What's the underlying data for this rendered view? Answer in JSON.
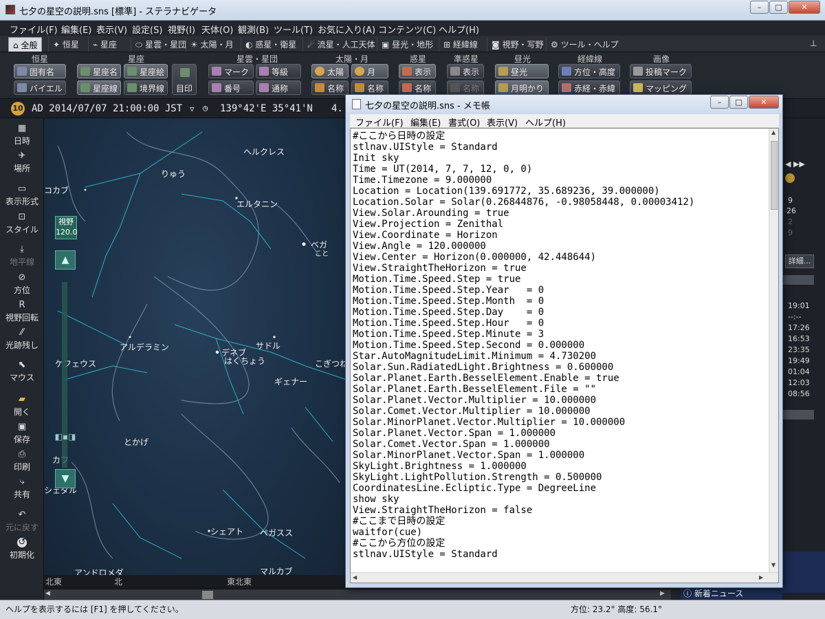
{
  "main": {
    "title": "七夕の星空の説明.sns [標準] - ステラナビゲータ",
    "menu": [
      "ファイル(F)",
      "編集(E)",
      "表示(V)",
      "設定(S)",
      "視野(I)",
      "天体(O)",
      "観測(B)",
      "ツール(T)",
      "お気に入り(A)",
      "コンテンツ(C)",
      "ヘルプ(H)"
    ],
    "tabs": [
      "全般",
      "恒星",
      "星座",
      "星雲・星団",
      "太陽・月",
      "惑星・衛星",
      "流星・人工天体",
      "昼光・地形",
      "経緯線",
      "視野・写野",
      "ツール・ヘルプ"
    ],
    "ribbon_groups": [
      "恒星",
      "星座",
      "星雲・星団",
      "太陽・月",
      "惑星",
      "準惑星",
      "昼光",
      "経緯線",
      "画像"
    ],
    "ribbon_buttons": {
      "star_name": "固有名",
      "bayer": "バイエル",
      "const_name": "星座名",
      "const_picture": "星座絵",
      "const_line": "星座線",
      "boundary": "境界線",
      "const_mark": "目印",
      "neb_mark": "マーク",
      "neb_magnitude": "等級",
      "neb_number": "番号",
      "neb_common": "通称",
      "sun": "太陽",
      "moon": "月",
      "sun_name": "名称",
      "moon_name": "名称",
      "planet_show": "表示",
      "planet_name": "名称",
      "dwarf_show": "表示",
      "dwarf_name": "名称",
      "daylight": "昼光",
      "moonlight": "月明かり",
      "azalt": "方位・高度",
      "radec": "赤経・赤緯",
      "post_mark": "投稿マーク",
      "mapping": "マッピング"
    },
    "status_line": {
      "datetime": "AD 2014/07/07 21:00:00 JST",
      "location": "139°42'E 35°41'N",
      "extra": "4."
    },
    "sidebar": [
      "日時",
      "場所",
      "表示形式",
      "スタイル",
      "地平線",
      "方位",
      "視野回転",
      "光跡残し",
      "マウス",
      "開く",
      "保存",
      "印刷",
      "共有",
      "元に戻す",
      "初期化"
    ],
    "fov_label": "視野",
    "fov_value": "120.0",
    "sky_labels": [
      "りゅう",
      "ヘルクレス",
      "エルタニン",
      "ベガ",
      "こと",
      "コカブ",
      "アルデラミン",
      "デネブ",
      "はくちょう",
      "サドル",
      "ケフェウス",
      "ギェナー",
      "こぎつね",
      "とかげ",
      "カフ",
      "シェダル",
      "シェアト",
      "ペガスス",
      "アンドロメダ",
      "マルカブ"
    ],
    "horizon_labels": [
      "北東",
      "北",
      "東北東"
    ],
    "statusbar": {
      "help": "ヘルプを表示するには [F1] を押してください。",
      "readout": "方位:  23.2°  高度:  56.1°"
    },
    "right_panel": {
      "detail_button": "詳細...",
      "numbers": [
        "9",
        "26",
        "2",
        "9"
      ],
      "times": [
        "19:01",
        "--:--",
        "17:26",
        "16:53",
        "23:35",
        "19:49",
        "01:04",
        "12:03",
        "08:56"
      ],
      "news": "新着ニュース"
    }
  },
  "notepad": {
    "title": "七夕の星空の説明.sns - メモ帳",
    "menu": [
      "ファイル(F)",
      "編集(E)",
      "書式(O)",
      "表示(V)",
      "ヘルプ(H)"
    ],
    "lines": [
      "#ここから日時の設定",
      "stlnav.UIStyle = Standard",
      "Init sky",
      "Time = UT(2014, 7, 7, 12, 0, 0)",
      "Time.Timezone = 9.000000",
      "Location = Location(139.691772, 35.689236, 39.000000)",
      "Location.Solar = Solar(0.26844876, -0.98058448, 0.00003412)",
      "View.Solar.Arounding = true",
      "View.Projection = Zenithal",
      "View.Coordinate = Horizon",
      "View.Angle = 120.000000",
      "View.Center = Horizon(0.000000, 42.448644)",
      "View.StraightTheHorizon = true",
      "Motion.Time.Speed.Step = true",
      "Motion.Time.Speed.Step.Year   = 0",
      "Motion.Time.Speed.Step.Month  = 0",
      "Motion.Time.Speed.Step.Day    = 0",
      "Motion.Time.Speed.Step.Hour   = 0",
      "Motion.Time.Speed.Step.Minute = 3",
      "Motion.Time.Speed.Step.Second = 0.000000",
      "Star.AutoMagnitudeLimit.Minimum = 4.730200",
      "Solar.Sun.RadiatedLight.Brightness = 0.600000",
      "Solar.Planet.Earth.BesselElement.Enable = true",
      "Solar.Planet.Earth.BesselElement.File = \"\"",
      "Solar.Planet.Vector.Multiplier = 10.000000",
      "Solar.Comet.Vector.Multiplier = 10.000000",
      "Solar.MinorPlanet.Vector.Multiplier = 10.000000",
      "Solar.Planet.Vector.Span = 1.000000",
      "Solar.Comet.Vector.Span = 1.000000",
      "Solar.MinorPlanet.Vector.Span = 1.000000",
      "SkyLight.Brightness = 1.000000",
      "SkyLight.LightPollution.Strength = 0.500000",
      "CoordinatesLine.Ecliptic.Type = DegreeLine",
      "show sky",
      "View.StraightTheHorizon = false",
      "#ここまで日時の設定",
      "waitfor(cue)",
      "#ここから方位の設定",
      "stlnav.UIStyle = Standard"
    ]
  }
}
